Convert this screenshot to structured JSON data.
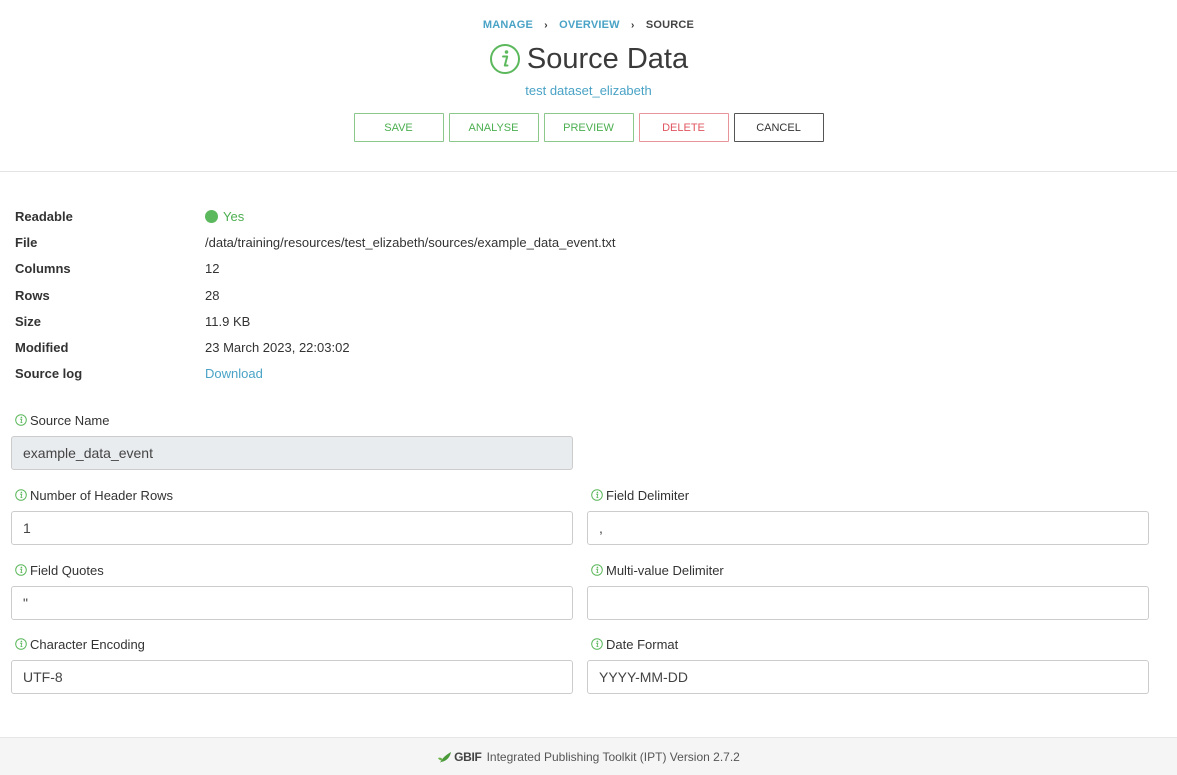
{
  "breadcrumb": {
    "items": [
      "MANAGE",
      "OVERVIEW"
    ],
    "current": "SOURCE",
    "separator": "›"
  },
  "page": {
    "title": "Source Data",
    "subtitle": "test dataset_elizabeth"
  },
  "actions": {
    "save": "SAVE",
    "analyse": "ANALYSE",
    "preview": "PREVIEW",
    "delete": "DELETE",
    "cancel": "CANCEL"
  },
  "info": {
    "readable_label": "Readable",
    "readable_value": "Yes",
    "file_label": "File",
    "file_value": "/data/training/resources/test_elizabeth/sources/example_data_event.txt",
    "columns_label": "Columns",
    "columns_value": "12",
    "rows_label": "Rows",
    "rows_value": "28",
    "size_label": "Size",
    "size_value": "11.9 KB",
    "modified_label": "Modified",
    "modified_value": "23 March 2023, 22:03:02",
    "sourcelog_label": "Source log",
    "sourcelog_value": "Download"
  },
  "form": {
    "source_name": {
      "label": "Source Name",
      "value": "example_data_event"
    },
    "header_rows": {
      "label": "Number of Header Rows",
      "value": "1"
    },
    "field_delimiter": {
      "label": "Field Delimiter",
      "value": ","
    },
    "field_quotes": {
      "label": "Field Quotes",
      "value": "\""
    },
    "multi_value_delimiter": {
      "label": "Multi-value Delimiter",
      "value": ""
    },
    "character_encoding": {
      "label": "Character Encoding",
      "value": "UTF-8"
    },
    "date_format": {
      "label": "Date Format",
      "value": "YYYY-MM-DD"
    }
  },
  "footer": {
    "logo_text": "GBIF",
    "text": "Integrated Publishing Toolkit (IPT) Version 2.7.2"
  },
  "colors": {
    "accent_link": "#4aa3c6",
    "success_green": "#4caf50",
    "danger_red": "#e05560"
  }
}
